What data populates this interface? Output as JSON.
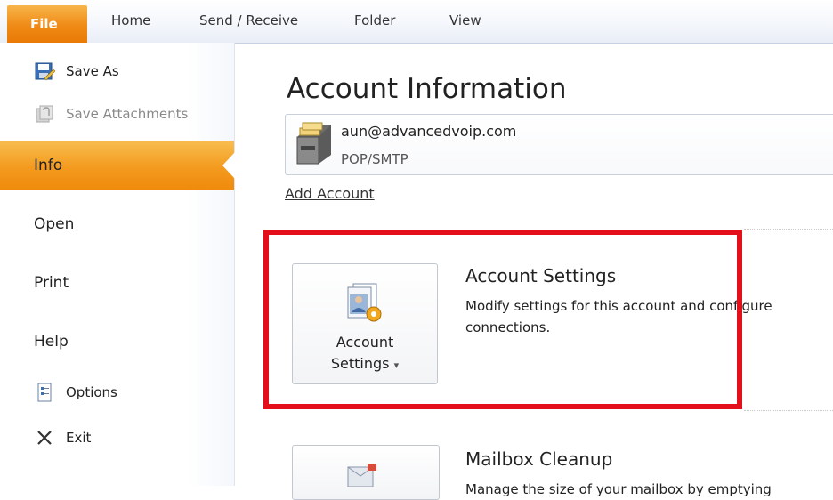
{
  "ribbon": {
    "tabs": [
      {
        "label": "File"
      },
      {
        "label": "Home"
      },
      {
        "label": "Send / Receive"
      },
      {
        "label": "Folder"
      },
      {
        "label": "View"
      }
    ]
  },
  "nav": {
    "commands_top": [
      {
        "label": "Save As",
        "icon": "save-as-icon",
        "disabled": false
      },
      {
        "label": "Save Attachments",
        "icon": "save-attachments-icon",
        "disabled": true
      }
    ],
    "items": [
      {
        "label": "Info",
        "selected": true
      },
      {
        "label": "Open"
      },
      {
        "label": "Print"
      },
      {
        "label": "Help"
      }
    ],
    "commands_bottom": [
      {
        "label": "Options",
        "icon": "options-icon"
      },
      {
        "label": "Exit",
        "icon": "exit-icon"
      }
    ]
  },
  "main": {
    "title": "Account Information",
    "account": {
      "email": "aun@advancedvoip.com",
      "type": "POP/SMTP",
      "icon": "mailbox-drawer-icon"
    },
    "add_account_label": "Add Account",
    "account_settings": {
      "button_line1": "Account",
      "button_line2": "Settings",
      "dropdown_glyph": "▾",
      "title": "Account Settings",
      "description_line1": "Modify settings for this account and configure",
      "description_line2": "connections."
    },
    "mailbox_cleanup": {
      "title": "Mailbox Cleanup",
      "description_line1": "Manage the size of your mailbox by emptying"
    }
  },
  "colors": {
    "accent_orange": "#f39a1e",
    "highlight_red": "#e3101c"
  }
}
